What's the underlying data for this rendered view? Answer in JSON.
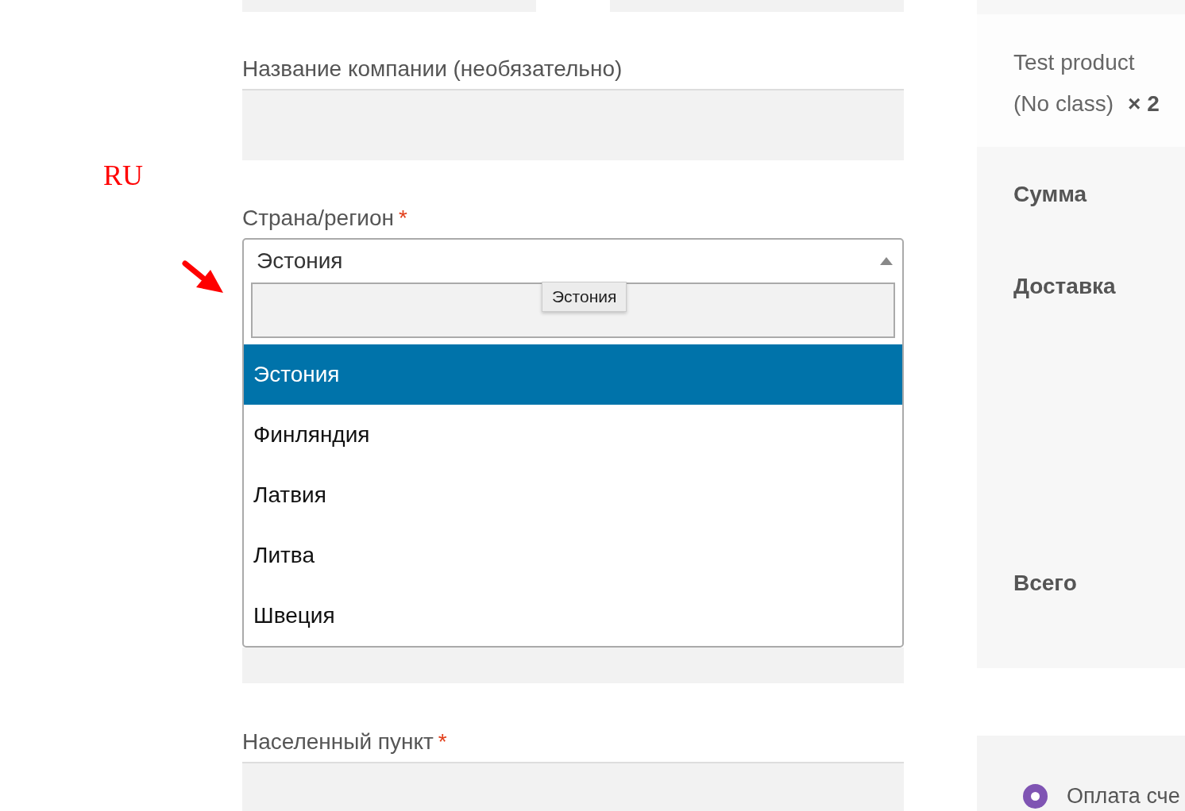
{
  "annotation": {
    "label": "RU"
  },
  "fields": [
    {
      "kind": "text",
      "label": "Название компании (необязательно)"
    },
    {
      "kind": "select",
      "label": "Страна/регион",
      "required_mark": "*",
      "value": "Эстония",
      "expanded": true,
      "tooltip": "Эстония",
      "options": [
        {
          "label": "Эстония",
          "selected": true
        },
        {
          "label": "Финляндия",
          "selected": false
        },
        {
          "label": "Латвия",
          "selected": false
        },
        {
          "label": "Литва",
          "selected": false
        },
        {
          "label": "Швеция",
          "selected": false
        }
      ]
    },
    {
      "kind": "text",
      "label": "Населенный пункт",
      "required_mark": "*"
    }
  ],
  "order_summary": {
    "product": {
      "name": "Test product",
      "variant": "(No class)",
      "quantity": "× 2"
    },
    "totals": [
      {
        "kind": "subtotal",
        "label": "Сумма"
      },
      {
        "kind": "shipping",
        "label": "Доставка"
      },
      {
        "kind": "total",
        "label": "Всего"
      }
    ]
  },
  "payment": {
    "methods": [
      {
        "label": "Оплата сче",
        "selected": true
      }
    ]
  }
}
